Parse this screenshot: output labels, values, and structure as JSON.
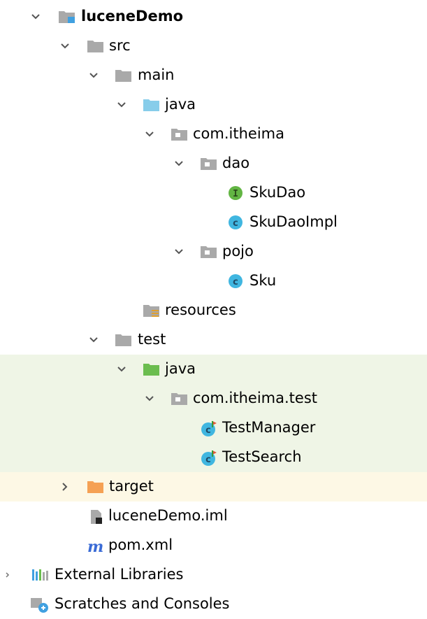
{
  "tree": {
    "project": "luceneDemo",
    "src": "src",
    "main": "main",
    "main_java": "java",
    "pkg_main": "com.itheima",
    "dao": "dao",
    "sku_dao": "SkuDao",
    "sku_dao_impl": "SkuDaoImpl",
    "pojo": "pojo",
    "sku": "Sku",
    "resources": "resources",
    "test": "test",
    "test_java": "java",
    "pkg_test": "com.itheima.test",
    "test_manager": "TestManager",
    "test_search": "TestSearch",
    "target": "target",
    "iml": "luceneDemo.iml",
    "pom": "pom.xml",
    "external_libraries": "External Libraries",
    "scratches": "Scratches and Consoles"
  },
  "colors": {
    "folder": "#a9a9a9",
    "source_folder": "#87cdea",
    "test_folder": "#6bbd4f",
    "excluded_folder": "#f5a154",
    "interface_icon": "#62b543",
    "class_icon": "#40b6e0",
    "test_bg": "#eff5e6",
    "excluded_bg": "#fdf8e5"
  },
  "icons": {
    "expand": "chevron-down-icon",
    "collapsed": "chevron-right-icon"
  }
}
